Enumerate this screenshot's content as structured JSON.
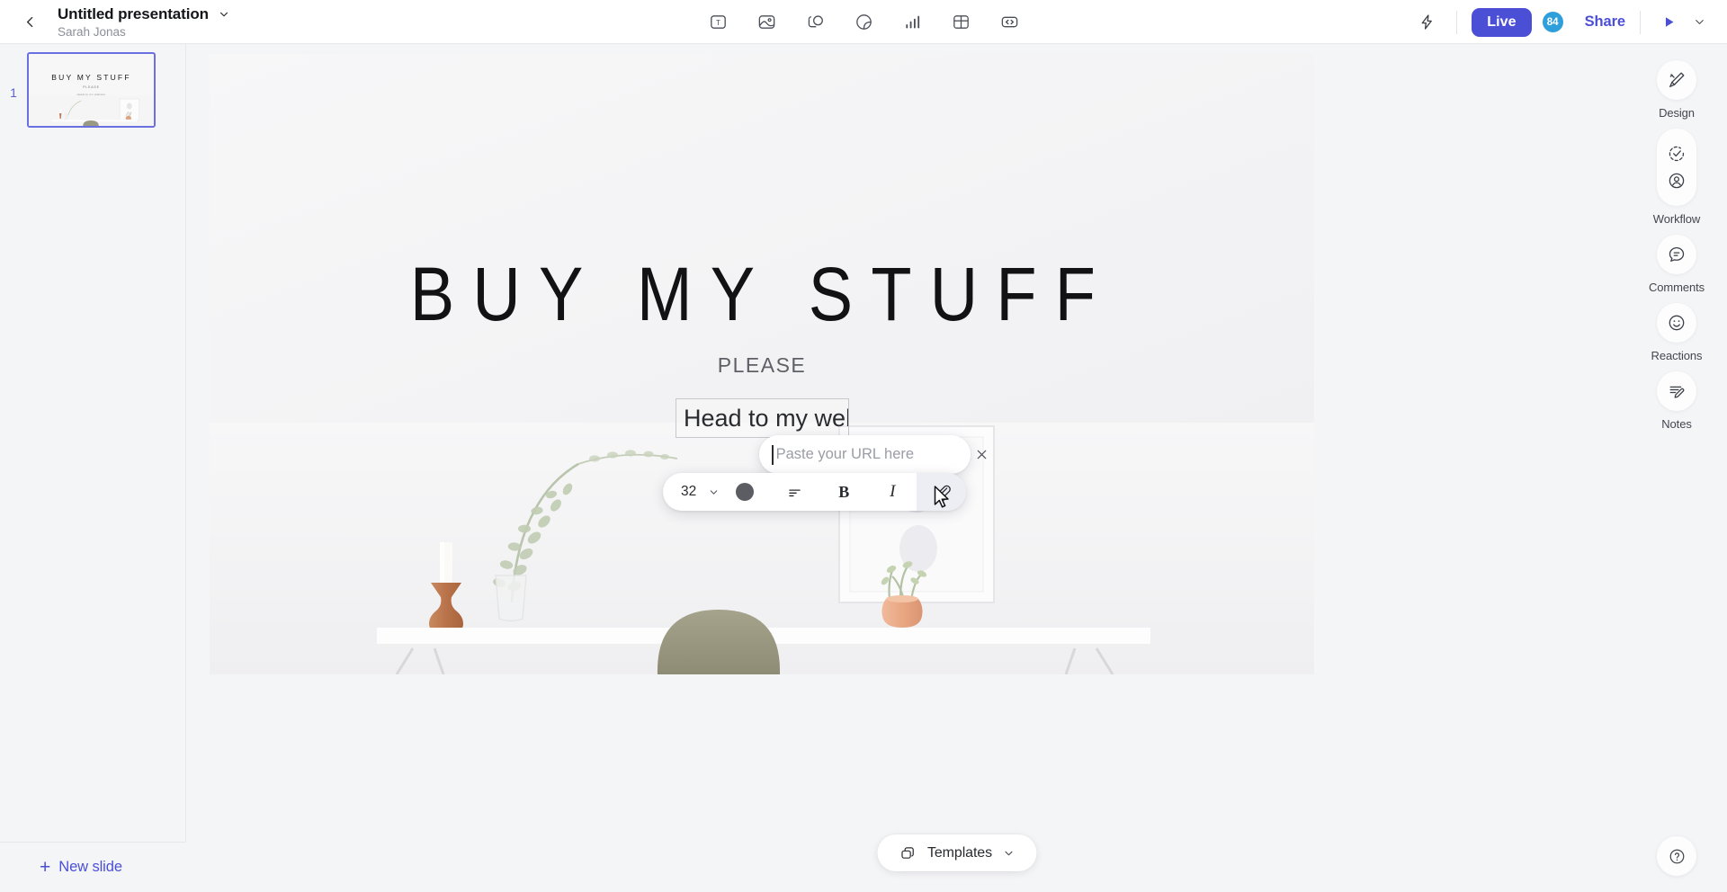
{
  "header": {
    "back_icon": "chevron-left-icon",
    "doc_title": "Untitled presentation",
    "title_caret_icon": "chevron-down-icon",
    "author": "Sarah Jonas",
    "tools": [
      {
        "name": "text-tool",
        "icon": "text-box-icon",
        "label": "T"
      },
      {
        "name": "image-tool",
        "icon": "image-icon"
      },
      {
        "name": "shapes-tool",
        "icon": "shapes-icon"
      },
      {
        "name": "sticker-tool",
        "icon": "sticker-icon"
      },
      {
        "name": "chart-tool",
        "icon": "bar-chart-icon"
      },
      {
        "name": "table-tool",
        "icon": "table-icon"
      },
      {
        "name": "embed-tool",
        "icon": "code-embed-icon"
      }
    ],
    "flash_icon": "lightning-bolt-icon",
    "live_label": "Live",
    "avatar_count": "84",
    "share_label": "Share",
    "play_icon": "play-triangle-icon",
    "play_caret_icon": "chevron-down-icon"
  },
  "slides_panel": {
    "slides": [
      {
        "number": "1",
        "thumb_title": "BUY MY STUFF",
        "thumb_subtitle": "PLEASE",
        "thumb_text": "Head to my website"
      }
    ],
    "new_slide_plus": "+",
    "new_slide_label": "New slide"
  },
  "slide": {
    "title": "BUY MY STUFF",
    "subtitle": "PLEASE",
    "link_textbox_value": "Head to my website"
  },
  "url_popup": {
    "placeholder": "Paste your URL here",
    "value": "",
    "close_icon": "close-x-icon"
  },
  "format_toolbar": {
    "font_size": "32",
    "size_caret_icon": "chevron-down-icon",
    "color_swatch": "#5c5d63",
    "align_icon": "align-left-icon",
    "bold_label": "B",
    "italic_label": "I",
    "link_icon": "link-paperclip-icon",
    "link_active": true
  },
  "templates": {
    "icon": "layers-icon",
    "label": "Templates",
    "caret_icon": "chevron-down-icon"
  },
  "right_sidebar": {
    "items": [
      {
        "name": "design",
        "label": "Design",
        "icon": "paintbrush-icon"
      },
      {
        "name": "workflow",
        "label": "Workflow",
        "icon": "check-circle-icon",
        "icon2": "person-circle-icon"
      },
      {
        "name": "comments",
        "label": "Comments",
        "icon": "comment-bubble-icon"
      },
      {
        "name": "reactions",
        "label": "Reactions",
        "icon": "smiley-face-icon"
      },
      {
        "name": "notes",
        "label": "Notes",
        "icon": "notes-pencil-icon"
      }
    ],
    "help_icon": "question-mark-icon"
  },
  "colors": {
    "brand_purple": "#4b4fd6",
    "avatar_blue": "#2f9fdc",
    "canvas_bg": "#f4f5f7",
    "slide_bg": "#f6f6f7"
  }
}
